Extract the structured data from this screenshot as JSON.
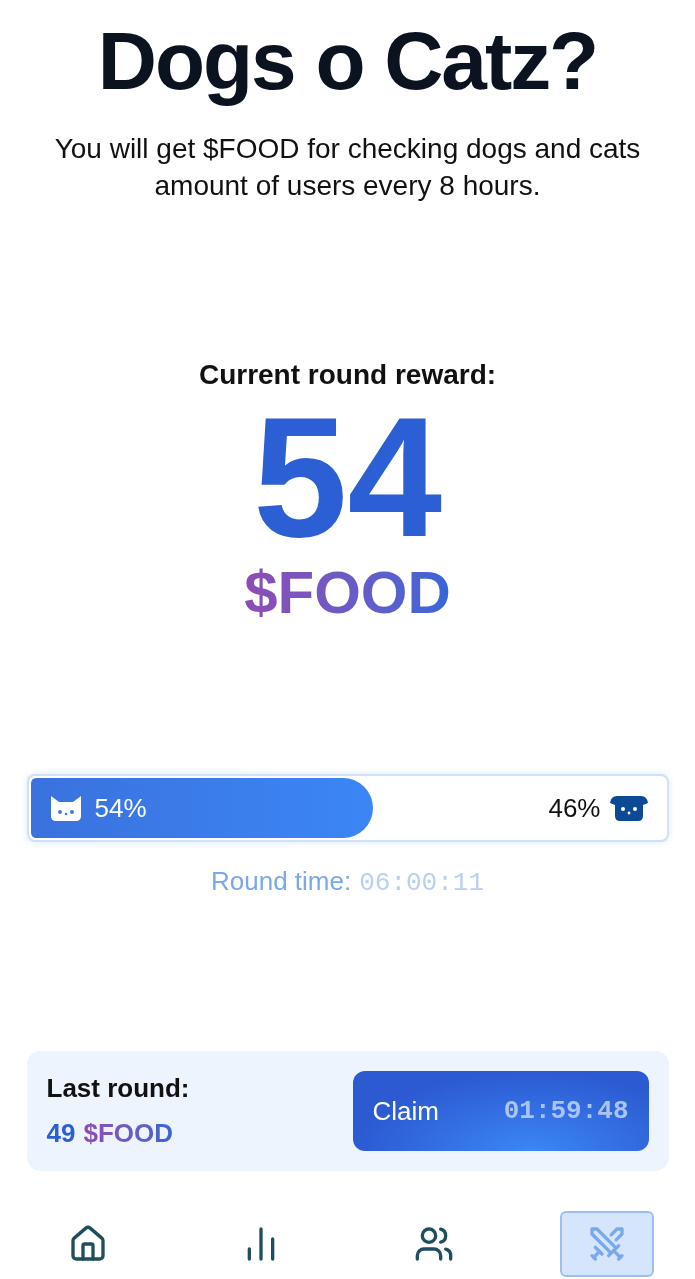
{
  "header": {
    "title": "Dogs o Catz?",
    "subtitle": "You will get $FOOD for checking dogs and cats amount of users every 8 hours."
  },
  "reward": {
    "label": "Current round reward:",
    "amount": "54",
    "unit": "$FOOD"
  },
  "vote": {
    "level": 0.54,
    "cats_percent": "54%",
    "dogs_percent": "46%"
  },
  "round_time": {
    "label": "Round time:",
    "value": "06:00:11"
  },
  "last_round": {
    "label": "Last round:",
    "amount": "49",
    "unit": "$FOOD",
    "claim_button": "Claim",
    "claim_timer": "01:59:48"
  },
  "nav": [
    {
      "kind": "home",
      "selected": false
    },
    {
      "kind": "stats",
      "selected": false
    },
    {
      "kind": "friends",
      "selected": false
    },
    {
      "kind": "battle",
      "selected": true
    }
  ]
}
